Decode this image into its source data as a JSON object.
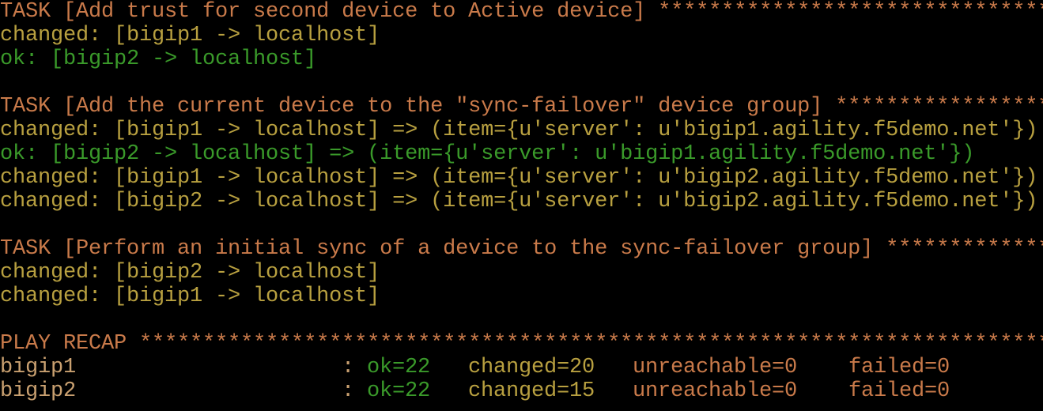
{
  "colors": {
    "task": "#c97a4a",
    "changed": "#b8a040",
    "ok": "#3a9a2a",
    "host": "#c9a070",
    "background": "#000000"
  },
  "lines": [
    {
      "kind": "task",
      "text": "TASK [Add trust for second device to Active device] ******************************************"
    },
    {
      "kind": "changed",
      "text": "changed: [bigip1 -> localhost]"
    },
    {
      "kind": "ok",
      "text": "ok: [bigip2 -> localhost]"
    },
    {
      "kind": "blank",
      "text": ""
    },
    {
      "kind": "task",
      "text": "TASK [Add the current device to the \"sync-failover\" device group] *****************************"
    },
    {
      "kind": "changed",
      "text": "changed: [bigip1 -> localhost] => (item={u'server': u'bigip1.agility.f5demo.net'})"
    },
    {
      "kind": "ok",
      "text": "ok: [bigip2 -> localhost] => (item={u'server': u'bigip1.agility.f5demo.net'})"
    },
    {
      "kind": "changed",
      "text": "changed: [bigip1 -> localhost] => (item={u'server': u'bigip2.agility.f5demo.net'})"
    },
    {
      "kind": "changed",
      "text": "changed: [bigip2 -> localhost] => (item={u'server': u'bigip2.agility.f5demo.net'})"
    },
    {
      "kind": "blank",
      "text": ""
    },
    {
      "kind": "task",
      "text": "TASK [Perform an initial sync of a device to the sync-failover group] *************************"
    },
    {
      "kind": "changed",
      "text": "changed: [bigip2 -> localhost]"
    },
    {
      "kind": "changed",
      "text": "changed: [bigip1 -> localhost]"
    },
    {
      "kind": "blank",
      "text": ""
    },
    {
      "kind": "task",
      "text": "PLAY RECAP **********************************************************************************"
    }
  ],
  "recap": [
    {
      "host": "bigip1",
      "sep": ":",
      "ok": "ok=22",
      "changed": "changed=20",
      "unreachable": "unreachable=0",
      "failed": "failed=0"
    },
    {
      "host": "bigip2",
      "sep": ":",
      "ok": "ok=22",
      "changed": "changed=15",
      "unreachable": "unreachable=0",
      "failed": "failed=0"
    }
  ]
}
